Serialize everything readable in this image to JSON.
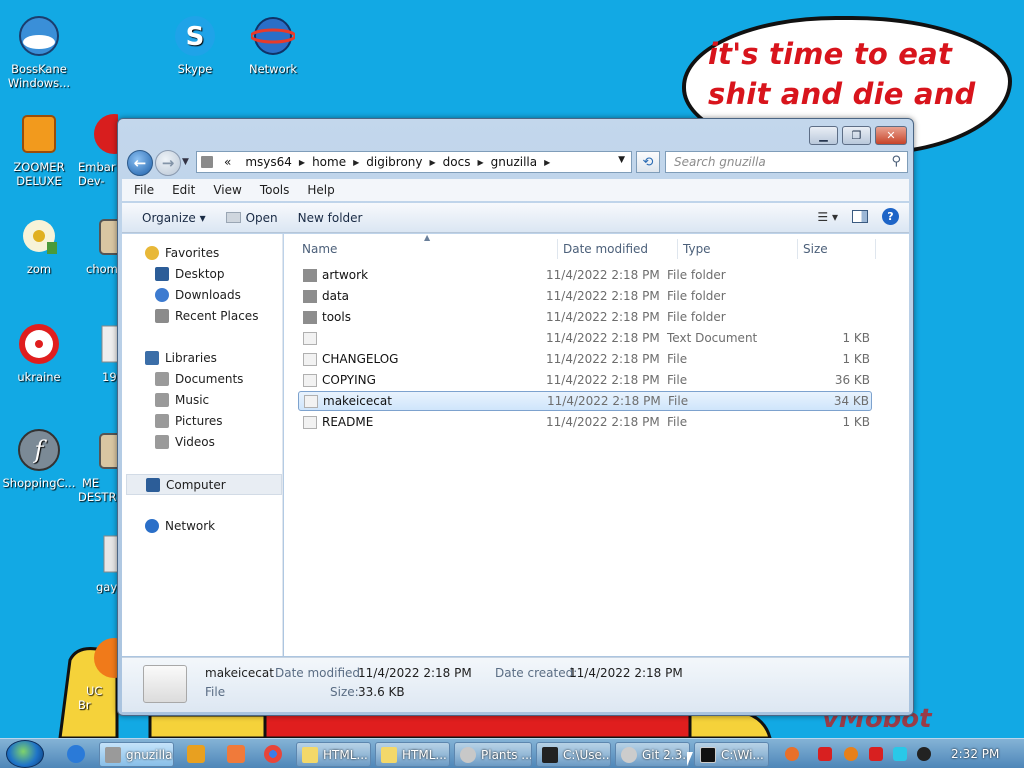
{
  "desktop": {
    "icons": [
      {
        "label": "BossKane Windows..."
      },
      {
        "label": "Skype"
      },
      {
        "label": "Network"
      },
      {
        "label": "ZOOMER DELUXE"
      },
      {
        "label": "Embar Dev-"
      },
      {
        "label": "zom"
      },
      {
        "label": "chom"
      },
      {
        "label": "ukraine"
      },
      {
        "label": "19"
      },
      {
        "label": "ShoppingC..."
      },
      {
        "label": "ME DESTR"
      },
      {
        "label": "gay"
      },
      {
        "label": "UC Br"
      }
    ],
    "speech_text": "it's time to eat shit and die and chew",
    "signature": "vMobot"
  },
  "window": {
    "address": {
      "overflow": "«",
      "segments": [
        "msys64",
        "home",
        "digibrony",
        "docs",
        "gnuzilla"
      ]
    },
    "search_placeholder": "Search gnuzilla",
    "menu": [
      "File",
      "Edit",
      "View",
      "Tools",
      "Help"
    ],
    "toolbar": {
      "organize": "Organize ▾",
      "open": "Open",
      "new_folder": "New folder"
    },
    "nav": {
      "favorites": "Favorites",
      "desktop": "Desktop",
      "downloads": "Downloads",
      "recent": "Recent Places",
      "libraries": "Libraries",
      "documents": "Documents",
      "music": "Music",
      "pictures": "Pictures",
      "videos": "Videos",
      "computer": "Computer",
      "network": "Network"
    },
    "columns": {
      "name": "Name",
      "date": "Date modified",
      "type": "Type",
      "size": "Size"
    },
    "files": [
      {
        "name": "artwork",
        "date": "11/4/2022 2:18 PM",
        "type": "File folder",
        "size": ""
      },
      {
        "name": "data",
        "date": "11/4/2022 2:18 PM",
        "type": "File folder",
        "size": ""
      },
      {
        "name": "tools",
        "date": "11/4/2022 2:18 PM",
        "type": "File folder",
        "size": ""
      },
      {
        "name": "",
        "date": "11/4/2022 2:18 PM",
        "type": "Text Document",
        "size": "1 KB"
      },
      {
        "name": "CHANGELOG",
        "date": "11/4/2022 2:18 PM",
        "type": "File",
        "size": "1 KB"
      },
      {
        "name": "COPYING",
        "date": "11/4/2022 2:18 PM",
        "type": "File",
        "size": "36 KB"
      },
      {
        "name": "makeicecat",
        "date": "11/4/2022 2:18 PM",
        "type": "File",
        "size": "34 KB"
      },
      {
        "name": "README",
        "date": "11/4/2022 2:18 PM",
        "type": "File",
        "size": "1 KB"
      }
    ],
    "details": {
      "name": "makeicecat",
      "kind": "File",
      "modified_label": "Date modified:",
      "modified_value": "11/4/2022 2:18 PM",
      "created_label": "Date created:",
      "created_value": "11/4/2022 2:18 PM",
      "size_label": "Size:",
      "size_value": "33.6 KB"
    }
  },
  "taskbar": {
    "buttons": [
      {
        "label": "gnuzilla"
      },
      {
        "label": "HTML..."
      },
      {
        "label": "HTML..."
      },
      {
        "label": "Plants ..."
      },
      {
        "label": "C:\\Use..."
      },
      {
        "label": "Git 2.3..."
      },
      {
        "label": "C:\\Wi..."
      }
    ],
    "clock": "2:32 PM"
  },
  "colors": {
    "accent": "#12a9e4",
    "speech_text": "#d8141c"
  }
}
